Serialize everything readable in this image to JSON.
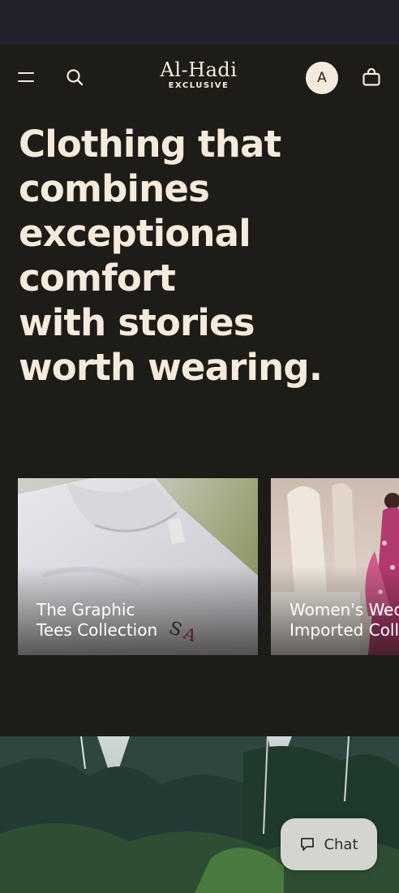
{
  "colors": {
    "background": "#1e1c18",
    "status_bar": "#22212c",
    "cream_text": "#f4ebdc",
    "chat_button": "#d5d5d0"
  },
  "header": {
    "menu_icon": "hamburger-menu-icon",
    "search_icon": "search-icon",
    "logo_main": "Al-Hadi",
    "logo_sub": "EXCLUSIVE",
    "account_initial": "A",
    "cart_icon": "shopping-bag-icon"
  },
  "hero": {
    "lines": [
      "Clothing that",
      "combines",
      "exceptional",
      "comfort",
      "with stories",
      "worth wearing."
    ]
  },
  "collections": [
    {
      "title_line1": "The Graphic",
      "title_line2": "Tees Collection"
    },
    {
      "title_line1": "Women's Wedding",
      "title_line2": "Imported Collection"
    }
  ],
  "chat": {
    "label": "Chat",
    "icon": "chat-bubble-icon"
  }
}
